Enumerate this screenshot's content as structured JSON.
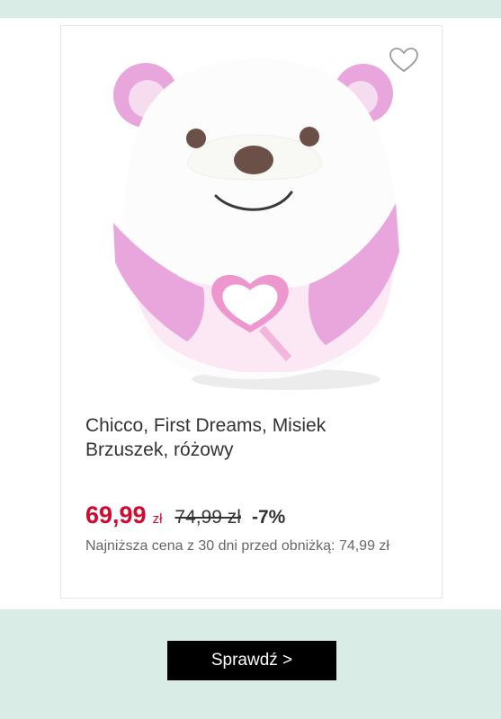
{
  "product": {
    "title": "Chicco, First Dreams, Misiek Brzuszek, różowy",
    "image_alt": "pink and white teddy bear pillow with heart",
    "favorite_icon": "heart-outline-icon"
  },
  "price": {
    "current": "69,99",
    "currency": "zł",
    "old": "74,99 zł",
    "discount": "-7%"
  },
  "lowest_price_note": "Najniższa cena z 30 dni przed obniżką: 74,99 zł",
  "cta": {
    "label": "Sprawdź >"
  },
  "colors": {
    "price": "#d20a2f",
    "background": "#d9ece6",
    "button": "#000000",
    "plush_pink": "#e9a6dc"
  }
}
